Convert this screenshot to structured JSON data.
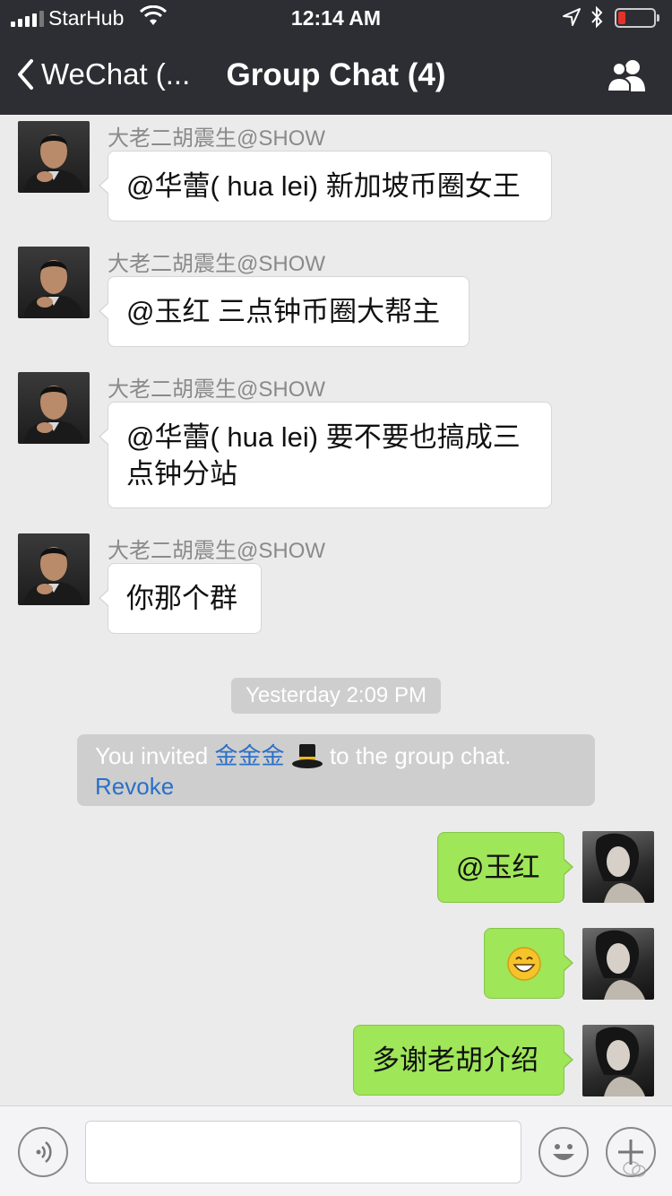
{
  "status_bar": {
    "carrier": "StarHub",
    "time": "12:14 AM",
    "battery_color": "#e4312b"
  },
  "nav": {
    "back_label": "WeChat (...",
    "title": "Group Chat (4)",
    "group_icon": "group-members-icon"
  },
  "messages": [
    {
      "sender": "大老二胡震生@SHOW",
      "text": "@华蕾( hua lei) 新加坡币圈女王"
    },
    {
      "sender": "大老二胡震生@SHOW",
      "text": "@玉红 三点钟币圈大帮主"
    },
    {
      "sender": "大老二胡震生@SHOW",
      "text_line1": "@华蕾( hua lei) 要不要也搞成三",
      "text_line2": "点钟分站"
    },
    {
      "sender": "大老二胡震生@SHOW",
      "text": "你那个群"
    }
  ],
  "timestamp": "Yesterday 2:09 PM",
  "system": {
    "prefix": "You invited ",
    "invitee": "金金金",
    "suffix": " to the group chat.",
    "revoke": "Revoke"
  },
  "own_messages": [
    {
      "text": "@玉红"
    },
    {
      "emoji": "grinning-face"
    },
    {
      "text": "多谢老胡介绍"
    }
  ],
  "colors": {
    "nav_bg": "#2d2e33",
    "chat_bg": "#ebebeb",
    "own_bubble": "#9fe658",
    "link": "#2a70c8"
  }
}
